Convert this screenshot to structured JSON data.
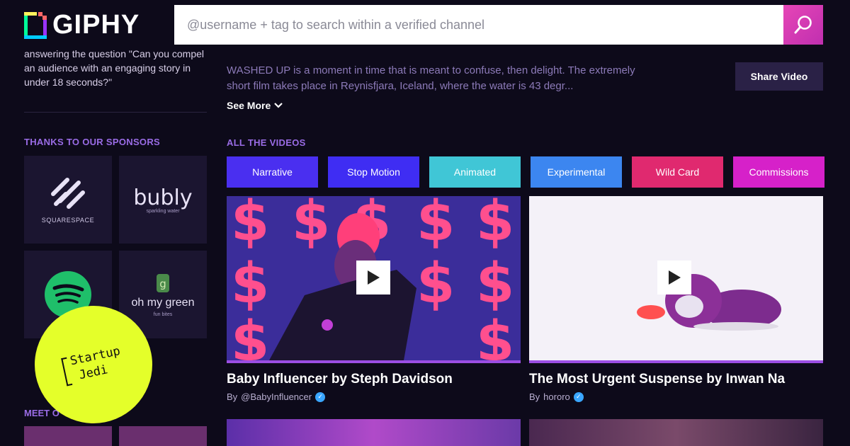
{
  "header": {
    "logo_text": "GIPHY",
    "search_placeholder": "@username + tag to search within a verified channel"
  },
  "sidebar": {
    "intro_text": "answering the question \"Can you compel an audience with an engaging story in under 18 seconds?\"",
    "sponsors_heading": "THANKS TO OUR SPONSORS",
    "sponsors": [
      {
        "name": "SQUARESPACE"
      },
      {
        "name": "bubly",
        "tagline": "sparkling water"
      },
      {
        "name": "Spotify"
      },
      {
        "name": "oh my green",
        "tagline": "fun bites"
      }
    ],
    "meet_heading": "MEET O"
  },
  "badge": {
    "line1": "Startup",
    "line2": "Jedi"
  },
  "main": {
    "description": "WASHED UP is a moment in time that is meant to confuse, then delight. The extremely short film takes place in Reynisfjara, Iceland, where the water is 43 degr...",
    "see_more": "See More",
    "share_button": "Share Video",
    "all_videos_heading": "ALL THE VIDEOS",
    "categories": [
      {
        "label": "Narrative",
        "color": "#4a2ff0"
      },
      {
        "label": "Stop Motion",
        "color": "#3f2df3"
      },
      {
        "label": "Animated",
        "color": "#40c6d6"
      },
      {
        "label": "Experimental",
        "color": "#3c86f0"
      },
      {
        "label": "Wild Card",
        "color": "#e0296f"
      },
      {
        "label": "Commissions",
        "color": "#d621c9"
      }
    ],
    "videos": [
      {
        "title": "Baby Influencer by Steph Davidson",
        "by_prefix": "By",
        "author": "@BabyInfluencer"
      },
      {
        "title": "The Most Urgent Suspense by Inwan Na",
        "by_prefix": "By",
        "author": "hororo"
      }
    ]
  },
  "colors": {
    "background": "#0d0a1a",
    "accent_purple": "#9a6ce6",
    "search_button": "#e646b6",
    "badge": "#e4ff2a"
  }
}
